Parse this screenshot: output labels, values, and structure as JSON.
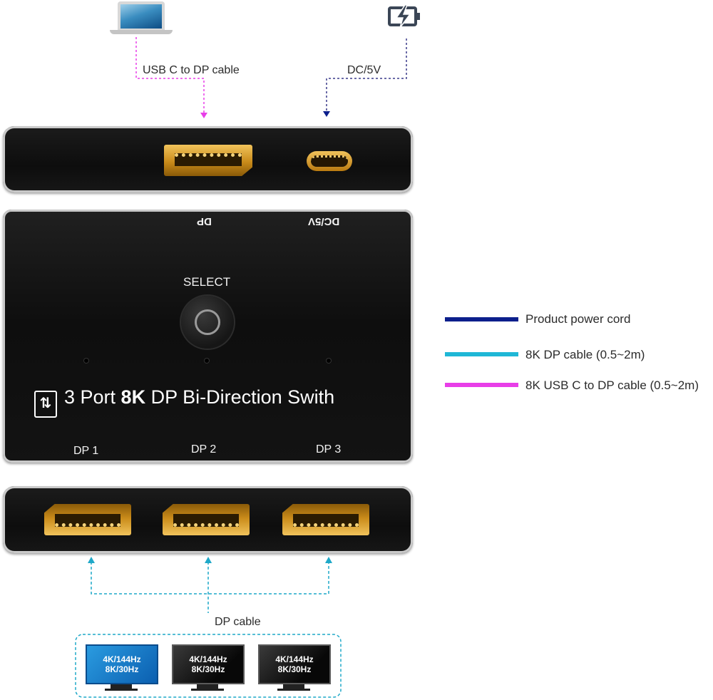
{
  "top_cable_label": "USB C to DP cable",
  "power_label": "DC/5V",
  "top_panel_labels": {
    "dp": "DP",
    "power": "DC/5V"
  },
  "select_label": "SELECT",
  "product_title": {
    "part1": "3 Port ",
    "bold": "8K",
    "part2": " DP Bi-Direction Swith"
  },
  "port_labels": [
    "DP 1",
    "DP 2",
    "DP 3"
  ],
  "bottom_cable_label": "DP cable",
  "legend": [
    {
      "label": "Product power cord",
      "color": "#0c1f8c"
    },
    {
      "label": "8K DP cable (0.5~2m)",
      "color": "#1fb7d6"
    },
    {
      "label": "8K USB C to DP cable (0.5~2m)",
      "color": "#e83ee8"
    }
  ],
  "monitors": [
    {
      "line1": "4K/144Hz",
      "line2": "8K/30Hz",
      "style": "blue"
    },
    {
      "line1": "4K/144Hz",
      "line2": "8K/30Hz",
      "style": "dark"
    },
    {
      "line1": "4K/144Hz",
      "line2": "8K/30Hz",
      "style": "dark"
    }
  ],
  "colors": {
    "pink": "#e83ee8",
    "navy": "#0c1f8c",
    "cyan": "#1fa8c8",
    "gold": "#d69a2a"
  }
}
